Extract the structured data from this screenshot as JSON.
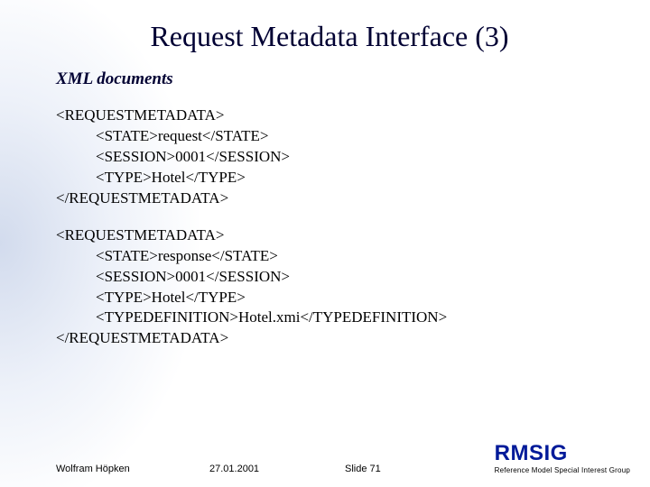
{
  "title": "Request Metadata Interface (3)",
  "subtitle": "XML documents",
  "block1": {
    "open": "<REQUESTMETADATA>",
    "line1": "<STATE>request</STATE>",
    "line2": "<SESSION>0001</SESSION>",
    "line3": "<TYPE>Hotel</TYPE>",
    "close": "</REQUESTMETADATA>"
  },
  "block2": {
    "open": "<REQUESTMETADATA>",
    "line1": "<STATE>response</STATE>",
    "line2": "<SESSION>0001</SESSION>",
    "line3": "<TYPE>Hotel</TYPE>",
    "line4": "<TYPEDEFINITION>Hotel.xmi</TYPEDEFINITION>",
    "close": "</REQUESTMETADATA>"
  },
  "footer": {
    "author": "Wolfram Höpken",
    "date": "27.01.2001",
    "slide": "Slide 71",
    "logo": "RMSIG",
    "tagline": "Reference Model Special Interest Group"
  }
}
